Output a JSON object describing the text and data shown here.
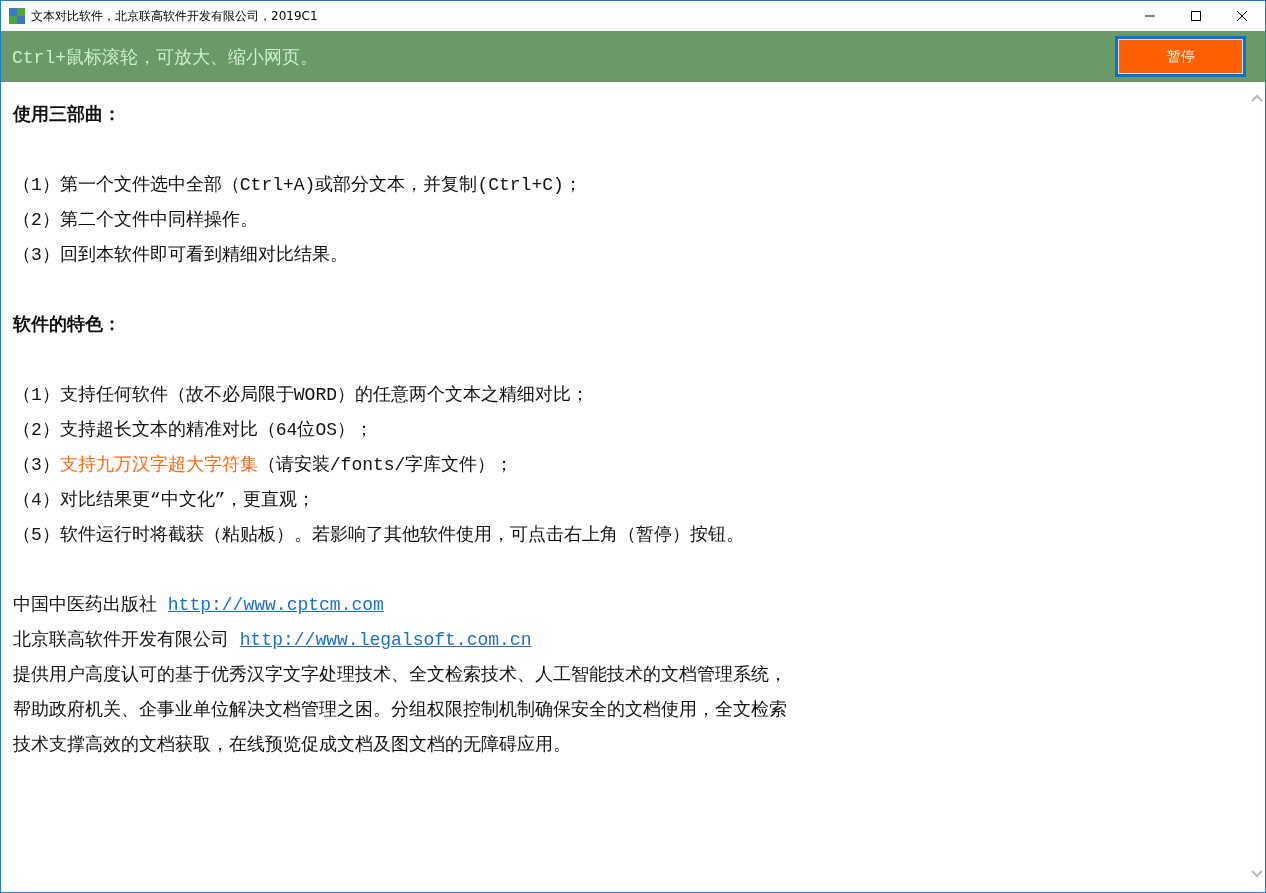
{
  "window": {
    "title": "文本对比软件，北京联高软件开发有限公司，2019C1"
  },
  "banner": {
    "hint": "Ctrl+鼠标滚轮，可放大、缩小网页。",
    "button": "暂停"
  },
  "sections": [
    {
      "heading": "使用三部曲：",
      "items": [
        {
          "segments": [
            {
              "kind": "plain",
              "text": "（1）第一个文件选中全部（Ctrl+A)或部分文本，并复制(Ctrl+C)；"
            }
          ]
        },
        {
          "segments": [
            {
              "kind": "plain",
              "text": "（2）第二个文件中同样操作。"
            }
          ]
        },
        {
          "segments": [
            {
              "kind": "plain",
              "text": "（3）回到本软件即可看到精细对比结果。"
            }
          ]
        }
      ]
    },
    {
      "heading": "软件的特色：",
      "items": [
        {
          "segments": [
            {
              "kind": "plain",
              "text": "（1）支持任何软件（故不必局限于WORD）的任意两个文本之精细对比；"
            }
          ]
        },
        {
          "segments": [
            {
              "kind": "plain",
              "text": "（2）支持超长文本的精准对比（64位OS）；"
            }
          ]
        },
        {
          "segments": [
            {
              "kind": "plain",
              "text": "（3）"
            },
            {
              "kind": "highlight",
              "text": "支持九万汉字超大字符集"
            },
            {
              "kind": "plain",
              "text": "（请安装/fonts/字库文件）；"
            }
          ]
        },
        {
          "segments": [
            {
              "kind": "plain",
              "text": "（4）对比结果更“中文化”，更直观；"
            }
          ]
        },
        {
          "segments": [
            {
              "kind": "plain",
              "text": "（5）软件运行时将截获（粘贴板）。若影响了其他软件使用，可点击右上角（暂停）按钮。"
            }
          ]
        }
      ]
    }
  ],
  "links": [
    {
      "label": "中国中医药出版社",
      "url": "http://www.cptcm.com"
    },
    {
      "label": "北京联高软件开发有限公司",
      "url": "http://www.legalsoft.com.cn"
    }
  ],
  "description": [
    "提供用户高度认可的基于优秀汉字文字处理技术、全文检索技术、人工智能技术的文档管理系统，",
    "帮助政府机关、企事业单位解决文档管理之困。分组权限控制机制确保安全的文档使用，全文检索",
    "技术支撑高效的文档获取，在线预览促成文档及图文档的无障碍应用。"
  ]
}
